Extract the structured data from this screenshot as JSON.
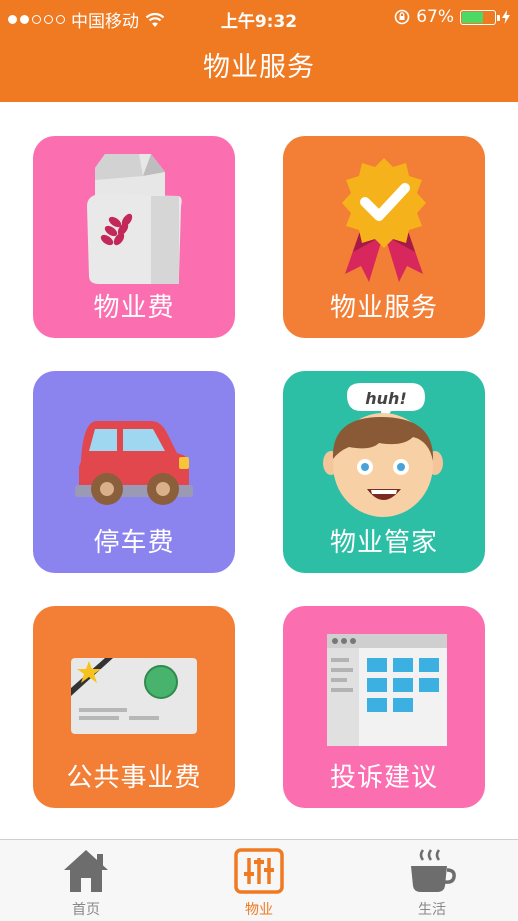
{
  "status_bar": {
    "carrier": "中国移动",
    "time": "上午9:32",
    "battery": "67%",
    "battery_level": 0.67,
    "signal_bars_filled": 2,
    "signal_bars_total": 5
  },
  "header": {
    "title": "物业服务"
  },
  "tiles": [
    {
      "label": "物业费",
      "color": "#fb6fb1",
      "icon": "feed-bag-icon"
    },
    {
      "label": "物业服务",
      "color": "#f27f35",
      "icon": "award-badge-icon"
    },
    {
      "label": "停车费",
      "color": "#8c84ee",
      "icon": "car-icon"
    },
    {
      "label": "物业管家",
      "color": "#2dbfa5",
      "icon": "butler-face-icon"
    },
    {
      "label": "公共事业费",
      "color": "#f27f35",
      "icon": "utility-card-icon"
    },
    {
      "label": "投诉建议",
      "color": "#fb6fb1",
      "icon": "feedback-form-icon"
    }
  ],
  "speech_bubble": "huh!",
  "tab_bar": {
    "active": "物业",
    "tabs": [
      {
        "label": "首页",
        "icon": "home-icon"
      },
      {
        "label": "物业",
        "icon": "property-icon"
      },
      {
        "label": "生活",
        "icon": "coffee-cup-icon"
      }
    ]
  },
  "colors": {
    "accent": "#ef7a22"
  }
}
